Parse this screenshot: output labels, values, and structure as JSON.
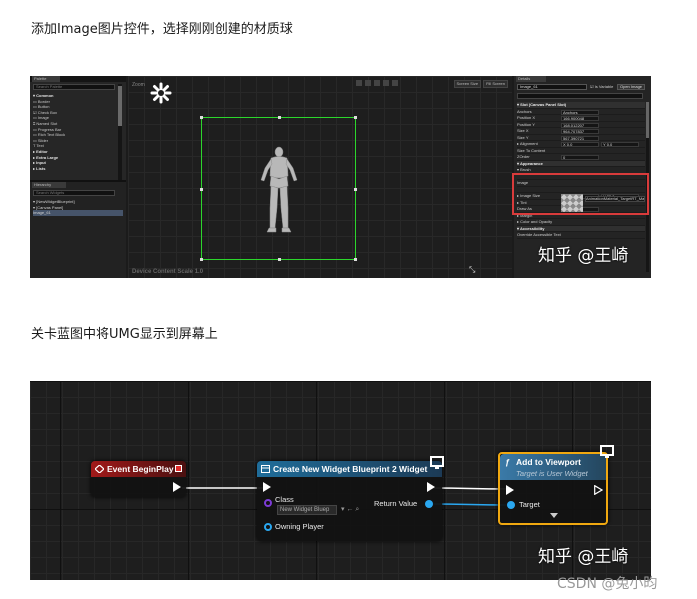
{
  "captions": {
    "first": "添加Image图片控件，选择刚刚创建的材质球",
    "second": "关卡蓝图中将UMG显示到屏幕上"
  },
  "umg_editor": {
    "viewport_label": "Zoom",
    "dpi_label": "Device Content Scale 1.0",
    "toolbar": [
      "Screen Size",
      "Fill Screen"
    ],
    "palette_search": "Search Palette",
    "palette_tab": "Palette",
    "palette_items": [
      {
        "label": "▾ Common",
        "cat": true
      },
      {
        "label": "  ▭ Border",
        "cat": false
      },
      {
        "label": "  ▭ Button",
        "cat": false
      },
      {
        "label": "  ☑ Check Box",
        "cat": false
      },
      {
        "label": "  ▭ Image",
        "cat": false
      },
      {
        "label": "  ⌗ Named Slot",
        "cat": false
      },
      {
        "label": "  ▭ Progress Bar",
        "cat": false
      },
      {
        "label": "  ▭ Rich Text Block",
        "cat": false
      },
      {
        "label": "  ▭ Slider",
        "cat": false
      },
      {
        "label": "  T Text",
        "cat": false
      },
      {
        "label": "▸ Editor",
        "cat": true
      },
      {
        "label": "▸ Extra Large",
        "cat": true
      },
      {
        "label": "▸ Input",
        "cat": true
      },
      {
        "label": "▸ Lists",
        "cat": true
      }
    ],
    "hierarchy_tab": "Hierarchy",
    "hierarchy_search": "Search Widgets",
    "hierarchy_items": [
      {
        "label": "▾ [NewWidgetBlueprint]",
        "sel": false
      },
      {
        "label": "  ▾ [Canvas Panel]",
        "sel": false
      },
      {
        "label": "     Image_61",
        "sel": true
      }
    ],
    "details_tab": "Details",
    "details_name": "Image_61",
    "details_is_variable": "☑ Is Variable",
    "details_open": "Open Image",
    "details_rows": [
      {
        "label": "▾ Slot (Canvas Panel Slot)",
        "sec": true,
        "v": "",
        "v2": ""
      },
      {
        "label": "  Anchors",
        "sec": false,
        "v": "Anchors",
        "v2": ""
      },
      {
        "label": "  Position X",
        "sec": false,
        "v": "166.900048",
        "v2": ""
      },
      {
        "label": "  Position Y",
        "sec": false,
        "v": "168.012207",
        "v2": ""
      },
      {
        "label": "  Size X",
        "sec": false,
        "v": "964.707837",
        "v2": ""
      },
      {
        "label": "  Size Y",
        "sec": false,
        "v": "567.390721",
        "v2": ""
      },
      {
        "label": "  ▸ Alignment",
        "sec": false,
        "v": "X 0.0",
        "v2": "Y 0.0"
      },
      {
        "label": "  Size To Content",
        "sec": false,
        "v": "",
        "v2": ""
      },
      {
        "label": "  ZOrder",
        "sec": false,
        "v": "0",
        "v2": ""
      },
      {
        "label": "▾ Appearance",
        "sec": true,
        "v": "",
        "v2": ""
      },
      {
        "label": "  ▾ Brush",
        "sec": false,
        "v": "",
        "v2": ""
      },
      {
        "label": "",
        "sec": false,
        "v": "",
        "v2": ""
      },
      {
        "label": "     Image",
        "sec": false,
        "v": "",
        "v2": ""
      },
      {
        "label": "",
        "sec": false,
        "v": "",
        "v2": ""
      },
      {
        "label": "     ▸ Image Size",
        "sec": false,
        "v": "X 32.0",
        "v2": "Y 32.0"
      },
      {
        "label": "     ▸ Tint",
        "sec": false,
        "v": "",
        "v2": ""
      },
      {
        "label": "       Draw As",
        "sec": false,
        "v": "Box",
        "v2": ""
      },
      {
        "label": "     ▸ Margin",
        "sec": false,
        "v": "",
        "v2": ""
      },
      {
        "label": "  ▸ Color and Opacity",
        "sec": false,
        "v": "",
        "v2": ""
      },
      {
        "label": "▾ Accessibility",
        "sec": true,
        "v": "",
        "v2": ""
      },
      {
        "label": "  Override Accessible Text",
        "sec": false,
        "v": "",
        "v2": ""
      }
    ],
    "brush_asset": "AnimationMaterial_TargetRT_Mat"
  },
  "blueprint": {
    "event_node": {
      "title": "Event BeginPlay"
    },
    "create_node": {
      "title": "Create New Widget Blueprint 2 Widget",
      "class_label": "Class",
      "class_value": "New Widget Bluep",
      "class_controls": "▾ ← ⌕",
      "return_label": "Return Value",
      "owning_label": "Owning Player"
    },
    "add_node": {
      "title": "Add to Viewport",
      "subtitle": "Target is User Widget",
      "target_label": "Target"
    },
    "colors": {
      "exec": "#ffffff",
      "object_pin": "#2aa7f0",
      "selected_outline": "#f0a810"
    }
  },
  "watermarks": {
    "zhihu_1": "知乎 @王崎",
    "zhihu_2": "知乎 @王崎",
    "csdn": "CSDN @兔小昀"
  }
}
